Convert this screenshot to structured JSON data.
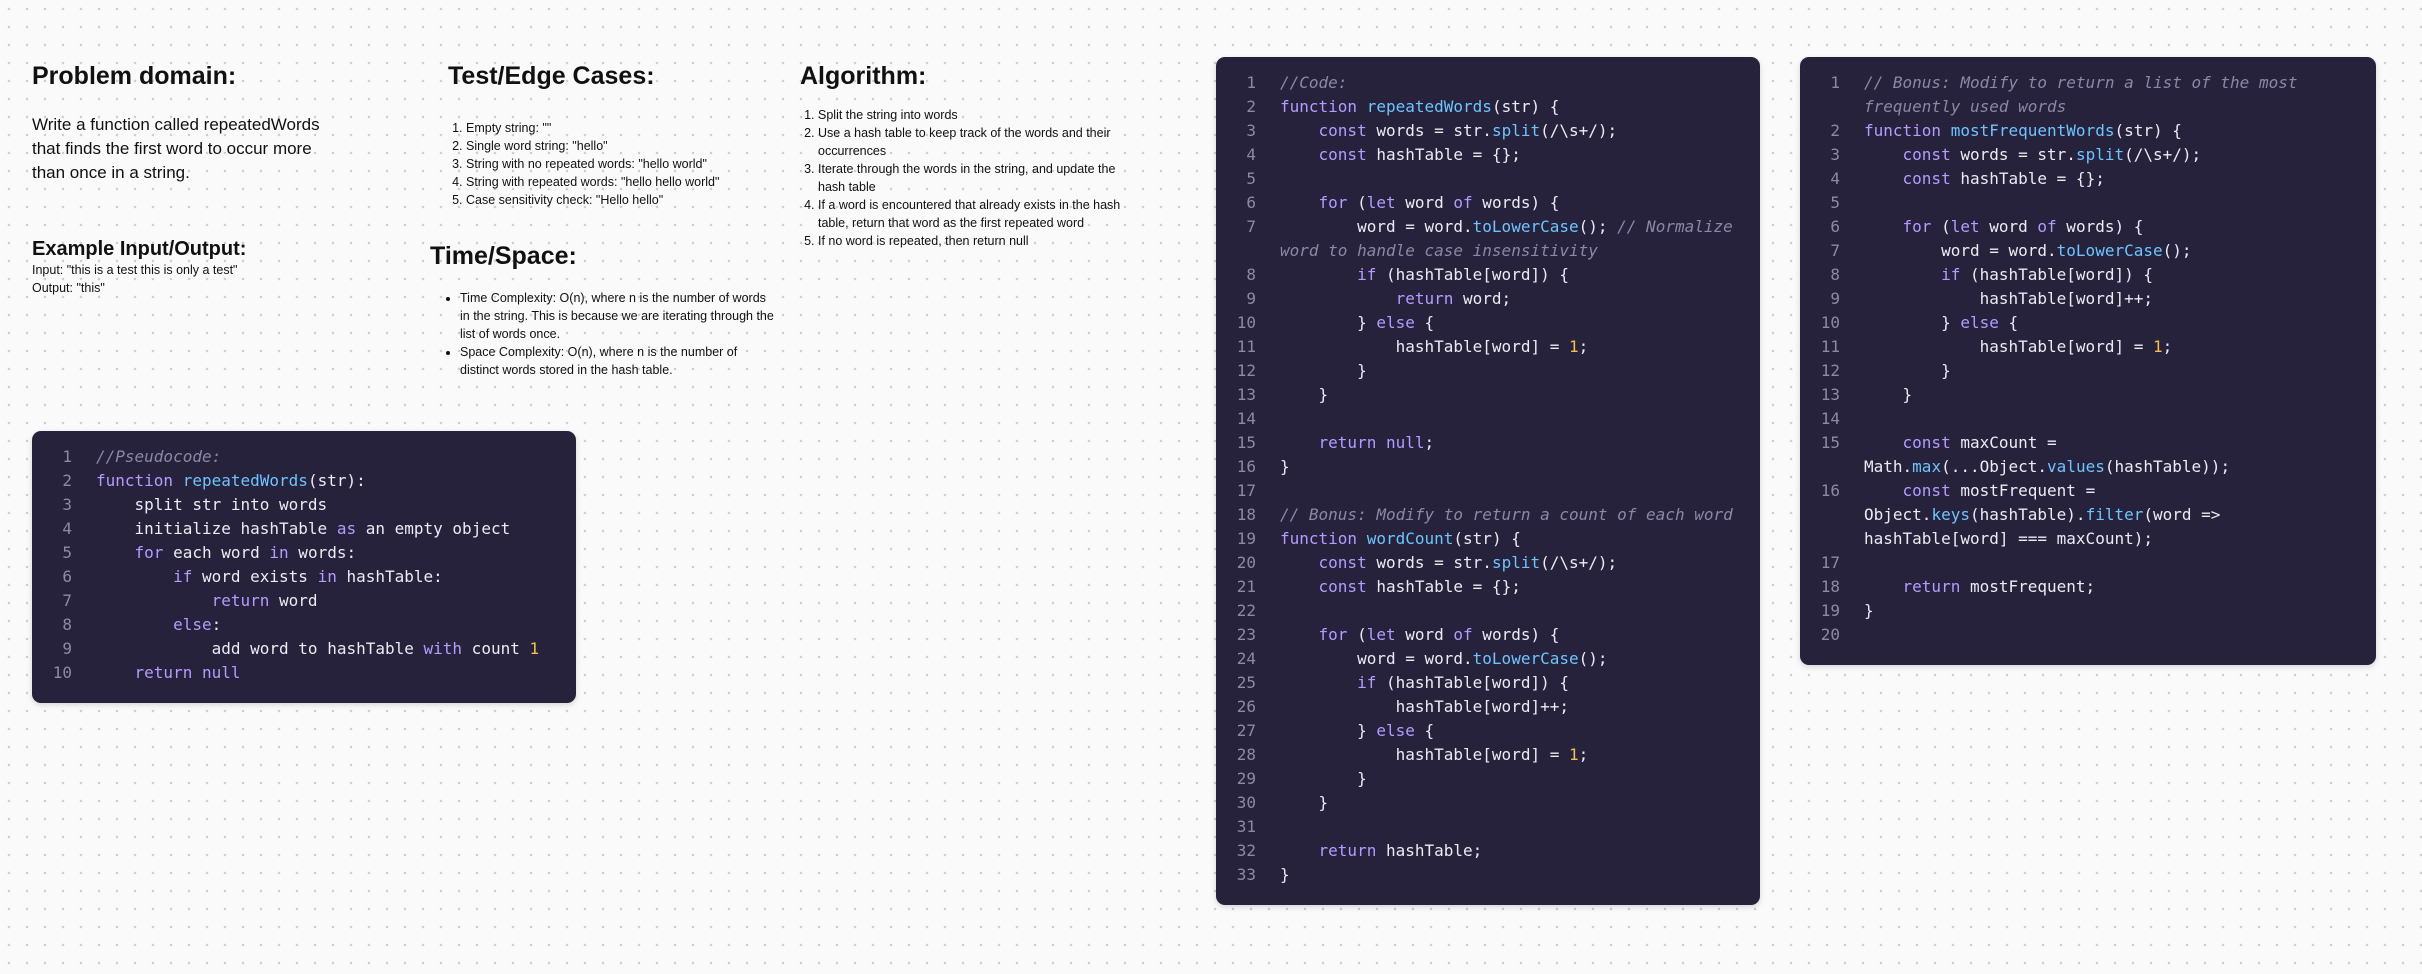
{
  "problem": {
    "heading": "Problem domain:",
    "text": "Write a function called repeatedWords that finds the first word to occur more than once in a string."
  },
  "example": {
    "heading": "Example Input/Output:",
    "input": "Input: \"this is a test this is only a test\"",
    "output": "Output: \"this\""
  },
  "tests": {
    "heading": "Test/Edge Cases:",
    "items": [
      "Empty string: \"\"",
      "Single word string: \"hello\"",
      "String with no repeated words: \"hello world\"",
      "String with repeated words: \"hello hello world\"",
      "Case sensitivity check: \"Hello hello\""
    ]
  },
  "timespace": {
    "heading": "Time/Space:",
    "items": [
      "Time Complexity: O(n), where n is the number of words in the string. This is because we are iterating through the list of words once.",
      "Space Complexity: O(n), where n is the number of distinct words stored in the hash table."
    ]
  },
  "algorithm": {
    "heading": "Algorithm:",
    "items": [
      "Split the string into words",
      "Use a hash table to keep track of the words and their occurrences",
      "Iterate through the words in the string, and update the hash table",
      "If a word is encountered that already exists in the hash table, return that word as the first repeated word",
      "If no word is repeated, then return null"
    ]
  },
  "pseudocode": {
    "lines": [
      [
        [
          "cm",
          "//Pseudocode:"
        ]
      ],
      [
        [
          "kw",
          "function "
        ],
        [
          "fn",
          "repeatedWords"
        ],
        [
          "t",
          "(str):"
        ]
      ],
      [
        [
          "t",
          "    split str into words"
        ]
      ],
      [
        [
          "t",
          "    initialize hashTable "
        ],
        [
          "kw",
          "as"
        ],
        [
          "t",
          " an empty object"
        ]
      ],
      [
        [
          "t",
          "    "
        ],
        [
          "kw",
          "for"
        ],
        [
          "t",
          " each word "
        ],
        [
          "kw",
          "in"
        ],
        [
          "t",
          " words:"
        ]
      ],
      [
        [
          "t",
          "        "
        ],
        [
          "kw",
          "if"
        ],
        [
          "t",
          " word exists "
        ],
        [
          "kw",
          "in"
        ],
        [
          "t",
          " hashTable:"
        ]
      ],
      [
        [
          "t",
          "            "
        ],
        [
          "kw",
          "return"
        ],
        [
          "t",
          " word"
        ]
      ],
      [
        [
          "t",
          "        "
        ],
        [
          "kw",
          "else"
        ],
        [
          "t",
          ":"
        ]
      ],
      [
        [
          "t",
          "            add word to hashTable "
        ],
        [
          "kw",
          "with"
        ],
        [
          "t",
          " count "
        ],
        [
          "num",
          "1"
        ]
      ],
      [
        [
          "t",
          "    "
        ],
        [
          "kw",
          "return"
        ],
        [
          "t",
          " "
        ],
        [
          "kw",
          "null"
        ]
      ]
    ]
  },
  "code": {
    "lines": [
      [
        [
          "cm",
          "//Code:"
        ]
      ],
      [
        [
          "kw",
          "function "
        ],
        [
          "fn",
          "repeatedWords"
        ],
        [
          "t",
          "(str) {"
        ]
      ],
      [
        [
          "t",
          "    "
        ],
        [
          "kw",
          "const"
        ],
        [
          "t",
          " words = str."
        ],
        [
          "fn",
          "split"
        ],
        [
          "t",
          "(/\\s+/);"
        ]
      ],
      [
        [
          "t",
          "    "
        ],
        [
          "kw",
          "const"
        ],
        [
          "t",
          " hashTable = {};"
        ]
      ],
      [
        [
          "t",
          ""
        ]
      ],
      [
        [
          "t",
          "    "
        ],
        [
          "kw",
          "for"
        ],
        [
          "t",
          " ("
        ],
        [
          "kw",
          "let"
        ],
        [
          "t",
          " word "
        ],
        [
          "kw",
          "of"
        ],
        [
          "t",
          " words) {"
        ]
      ],
      [
        [
          "t",
          "        word = word."
        ],
        [
          "fn",
          "toLowerCase"
        ],
        [
          "t",
          "(); "
        ],
        [
          "cm",
          "// Normalize word to handle case insensitivity"
        ]
      ],
      [
        [
          "t",
          "        "
        ],
        [
          "kw",
          "if"
        ],
        [
          "t",
          " (hashTable[word]) {"
        ]
      ],
      [
        [
          "t",
          "            "
        ],
        [
          "kw",
          "return"
        ],
        [
          "t",
          " word;"
        ]
      ],
      [
        [
          "t",
          "        } "
        ],
        [
          "kw",
          "else"
        ],
        [
          "t",
          " {"
        ]
      ],
      [
        [
          "t",
          "            hashTable[word] = "
        ],
        [
          "num",
          "1"
        ],
        [
          "t",
          ";"
        ]
      ],
      [
        [
          "t",
          "        }"
        ]
      ],
      [
        [
          "t",
          "    }"
        ]
      ],
      [
        [
          "t",
          ""
        ]
      ],
      [
        [
          "t",
          "    "
        ],
        [
          "kw",
          "return"
        ],
        [
          "t",
          " "
        ],
        [
          "kw",
          "null"
        ],
        [
          "t",
          ";"
        ]
      ],
      [
        [
          "t",
          "}"
        ]
      ],
      [
        [
          "t",
          ""
        ]
      ],
      [
        [
          "cm",
          "// Bonus: Modify to return a count of each word"
        ]
      ],
      [
        [
          "kw",
          "function "
        ],
        [
          "fn",
          "wordCount"
        ],
        [
          "t",
          "(str) {"
        ]
      ],
      [
        [
          "t",
          "    "
        ],
        [
          "kw",
          "const"
        ],
        [
          "t",
          " words = str."
        ],
        [
          "fn",
          "split"
        ],
        [
          "t",
          "(/\\s+/);"
        ]
      ],
      [
        [
          "t",
          "    "
        ],
        [
          "kw",
          "const"
        ],
        [
          "t",
          " hashTable = {};"
        ]
      ],
      [
        [
          "t",
          ""
        ]
      ],
      [
        [
          "t",
          "    "
        ],
        [
          "kw",
          "for"
        ],
        [
          "t",
          " ("
        ],
        [
          "kw",
          "let"
        ],
        [
          "t",
          " word "
        ],
        [
          "kw",
          "of"
        ],
        [
          "t",
          " words) {"
        ]
      ],
      [
        [
          "t",
          "        word = word."
        ],
        [
          "fn",
          "toLowerCase"
        ],
        [
          "t",
          "();"
        ]
      ],
      [
        [
          "t",
          "        "
        ],
        [
          "kw",
          "if"
        ],
        [
          "t",
          " (hashTable[word]) {"
        ]
      ],
      [
        [
          "t",
          "            hashTable[word]++;"
        ]
      ],
      [
        [
          "t",
          "        } "
        ],
        [
          "kw",
          "else"
        ],
        [
          "t",
          " {"
        ]
      ],
      [
        [
          "t",
          "            hashTable[word] = "
        ],
        [
          "num",
          "1"
        ],
        [
          "t",
          ";"
        ]
      ],
      [
        [
          "t",
          "        }"
        ]
      ],
      [
        [
          "t",
          "    }"
        ]
      ],
      [
        [
          "t",
          ""
        ]
      ],
      [
        [
          "t",
          "    "
        ],
        [
          "kw",
          "return"
        ],
        [
          "t",
          " hashTable;"
        ]
      ],
      [
        [
          "t",
          "}"
        ]
      ]
    ]
  },
  "bonus": {
    "lines": [
      [
        [
          "cm",
          "// Bonus: Modify to return a list of the most frequently used words"
        ]
      ],
      [
        [
          "kw",
          "function "
        ],
        [
          "fn",
          "mostFrequentWords"
        ],
        [
          "t",
          "(str) {"
        ]
      ],
      [
        [
          "t",
          "    "
        ],
        [
          "kw",
          "const"
        ],
        [
          "t",
          " words = str."
        ],
        [
          "fn",
          "split"
        ],
        [
          "t",
          "(/\\s+/);"
        ]
      ],
      [
        [
          "t",
          "    "
        ],
        [
          "kw",
          "const"
        ],
        [
          "t",
          " hashTable = {};"
        ]
      ],
      [
        [
          "t",
          ""
        ]
      ],
      [
        [
          "t",
          "    "
        ],
        [
          "kw",
          "for"
        ],
        [
          "t",
          " ("
        ],
        [
          "kw",
          "let"
        ],
        [
          "t",
          " word "
        ],
        [
          "kw",
          "of"
        ],
        [
          "t",
          " words) {"
        ]
      ],
      [
        [
          "t",
          "        word = word."
        ],
        [
          "fn",
          "toLowerCase"
        ],
        [
          "t",
          "();"
        ]
      ],
      [
        [
          "t",
          "        "
        ],
        [
          "kw",
          "if"
        ],
        [
          "t",
          " (hashTable[word]) {"
        ]
      ],
      [
        [
          "t",
          "            hashTable[word]++;"
        ]
      ],
      [
        [
          "t",
          "        } "
        ],
        [
          "kw",
          "else"
        ],
        [
          "t",
          " {"
        ]
      ],
      [
        [
          "t",
          "            hashTable[word] = "
        ],
        [
          "num",
          "1"
        ],
        [
          "t",
          ";"
        ]
      ],
      [
        [
          "t",
          "        }"
        ]
      ],
      [
        [
          "t",
          "    }"
        ]
      ],
      [
        [
          "t",
          ""
        ]
      ],
      [
        [
          "t",
          "    "
        ],
        [
          "kw",
          "const"
        ],
        [
          "t",
          " maxCount = Math."
        ],
        [
          "fn",
          "max"
        ],
        [
          "t",
          "(...Object."
        ],
        [
          "fn",
          "values"
        ],
        [
          "t",
          "(hashTable));"
        ]
      ],
      [
        [
          "t",
          "    "
        ],
        [
          "kw",
          "const"
        ],
        [
          "t",
          " mostFrequent = Object."
        ],
        [
          "fn",
          "keys"
        ],
        [
          "t",
          "(hashTable)."
        ],
        [
          "fn",
          "filter"
        ],
        [
          "t",
          "(word => hashTable[word] === maxCount);"
        ]
      ],
      [
        [
          "t",
          ""
        ]
      ],
      [
        [
          "t",
          "    "
        ],
        [
          "kw",
          "return"
        ],
        [
          "t",
          " mostFrequent;"
        ]
      ],
      [
        [
          "t",
          "}"
        ]
      ],
      [
        [
          "t",
          ""
        ]
      ]
    ]
  }
}
